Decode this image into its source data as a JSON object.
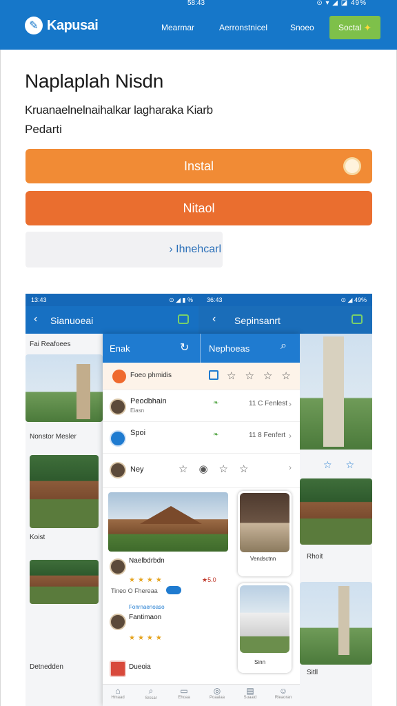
{
  "status": {
    "time": "58:43",
    "icons": "⊙ ▾ ◢ ◪ 49%"
  },
  "header": {
    "brand": "Kapusai",
    "nav": [
      "Mearmar",
      "Aerronstnicel",
      "Snoeo"
    ],
    "cta": "Soctal"
  },
  "hero": {
    "title": "Naplaplah Nisdn",
    "subtitle_line1": "Kruanaelnelnaihalkar lagharaka Kiarb",
    "subtitle_line2": "Pedarti"
  },
  "buttons": {
    "install": "Instal",
    "secondary": "Nitaol",
    "tertiary": "› Ihnehcarl"
  },
  "mock": {
    "left_time": "13:43",
    "left_status": "⊙ ◢ ▮ %",
    "left_title": "Sianuoeai",
    "mid_time": "36:43",
    "mid_status": "⊙ ◢ 49%",
    "right_title": "Sepinsanrt",
    "left_items": [
      "Fai Reafoees",
      "Nonstor Mesler",
      "Koist",
      "Detnedden"
    ],
    "center": {
      "head_left": "Enak",
      "head_right": "Nephoeas",
      "filter_label": "Foeo phmidis",
      "rows": [
        {
          "name": "Peodbhain",
          "meta": "Eiasn",
          "right": "11 C Fenlest"
        },
        {
          "name": "Spoi",
          "meta": "",
          "right": "11 8 Fenfert"
        },
        {
          "name": "Ney",
          "meta": "",
          "right": ""
        }
      ],
      "reviews": [
        {
          "name": "Naelbdrbdn",
          "line": "",
          "score": "★5.0"
        },
        {
          "name": "Fantimaon",
          "line": "Fonrnaenoaso",
          "score": ""
        },
        {
          "name": "Dueoia",
          "line": "",
          "score": ""
        }
      ],
      "meta_line": "Tineo O Fhereaa",
      "side_card_label": "Vendsctnn",
      "side_card2_label": "Sinn",
      "tabs": [
        "Hmaad",
        "Srcsar",
        "Ehoaa",
        "Poaaiaa",
        "Suaaid",
        "Rleaoran"
      ]
    },
    "right_items": [
      "Rhoit",
      "Sitll"
    ]
  },
  "colors": {
    "brand_blue": "#1677c9",
    "install_orange": "#f18b35",
    "secondary_orange": "#ea6e2f",
    "cta_green": "#7ec04a"
  }
}
